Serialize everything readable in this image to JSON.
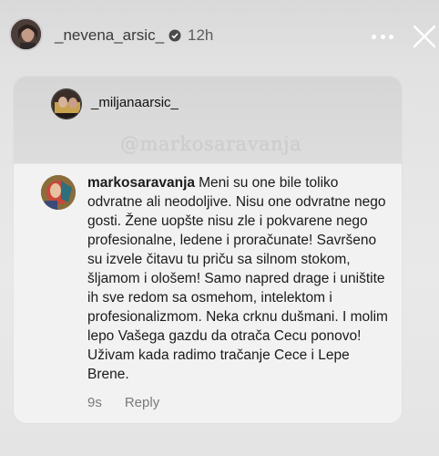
{
  "story": {
    "username": "_nevena_arsic_",
    "time": "12h",
    "icons": {
      "verified": "verified-badge-icon",
      "more": "more-options-icon",
      "close": "close-icon"
    }
  },
  "shared_post": {
    "username": "_miljanaarsic_",
    "watermark": "@markosaravanja"
  },
  "comment": {
    "author": "markosaravanja",
    "text": "Meni su one bile toliko odvratne ali neodoljive. Nisu one odvratne nego gosti. Žene uopšte nisu zle i pokvarene nego profesionalne, ledene i proračunate! Savršeno su izvele čitavu tu priču sa silnom stokom, šljamom i ološem! Samo napred drage i uništite ih sve redom sa osmehom, intelektom i profesionalizmom. Neka crknu dušmani. I molim lepo Vašega gazdu da otrača Cecu ponovo! Uživam kada radimo tračanje Cece i Lepe Brene.",
    "age": "9s",
    "reply_label": "Reply"
  },
  "colors": {
    "background": "#e4e4e4",
    "card": "#e6e6e6",
    "comment_bg": "#f2f2f2"
  }
}
